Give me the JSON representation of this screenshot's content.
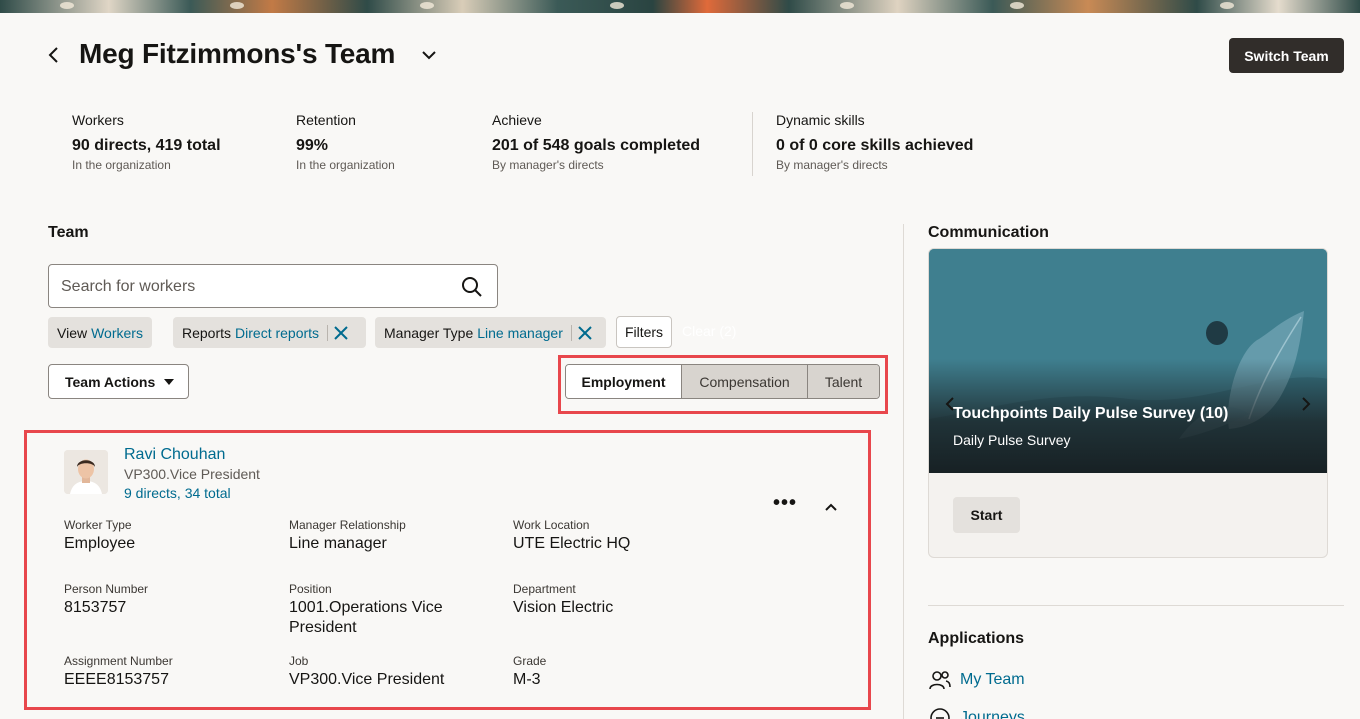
{
  "header": {
    "title": "Meg Fitzimmons's Team",
    "switch_team_label": "Switch Team"
  },
  "metrics": [
    {
      "label": "Workers",
      "value": "90 directs, 419 total",
      "sub": "In the organization"
    },
    {
      "label": "Retention",
      "value": "99%",
      "sub": "In the organization"
    },
    {
      "label": "Achieve",
      "value": "201 of 548 goals completed",
      "sub": "By manager's directs"
    },
    {
      "label": "Dynamic skills",
      "value": "0 of 0 core skills achieved",
      "sub": "By manager's directs"
    }
  ],
  "team": {
    "section_title": "Team",
    "search_placeholder": "Search for workers",
    "chips": [
      {
        "key": "View",
        "value": "Workers"
      },
      {
        "key": "Reports",
        "value": "Direct reports"
      },
      {
        "key": "Manager Type",
        "value": "Line manager"
      }
    ],
    "filters_label": "Filters",
    "clear_label": "Clear (2)",
    "team_actions_label": "Team Actions",
    "view_tabs": [
      "Employment",
      "Compensation",
      "Talent"
    ],
    "selected_tab": "Employment"
  },
  "employee": {
    "name": "Ravi Chouhan",
    "job": "VP300.Vice President",
    "directs": "9 directs, 34 total",
    "more_label": "•••",
    "fields": [
      {
        "label": "Worker Type",
        "value": "Employee"
      },
      {
        "label": "Manager Relationship",
        "value": "Line manager"
      },
      {
        "label": "Work Location",
        "value": "UTE Electric HQ"
      },
      {
        "label": "Person Number",
        "value": "8153757"
      },
      {
        "label": "Position",
        "value": "1001.Operations Vice President"
      },
      {
        "label": "Department",
        "value": "Vision Electric"
      },
      {
        "label": "Assignment Number",
        "value": "EEEE8153757"
      },
      {
        "label": "Job",
        "value": "VP300.Vice President"
      },
      {
        "label": "Grade",
        "value": "M-3"
      }
    ]
  },
  "communication": {
    "section_title": "Communication",
    "card_title": "Touchpoints Daily Pulse Survey (10)",
    "card_subtitle": "Daily Pulse Survey",
    "start_label": "Start"
  },
  "applications": {
    "section_title": "Applications",
    "items": [
      {
        "label": "My Team",
        "icon": "people-icon"
      },
      {
        "label": "Journeys",
        "icon": "journey-icon"
      }
    ]
  },
  "colors": {
    "link": "#006b8f",
    "highlight": "#e8474c",
    "primary_button": "#312d2a",
    "survey_image": "#3f7f8f"
  }
}
